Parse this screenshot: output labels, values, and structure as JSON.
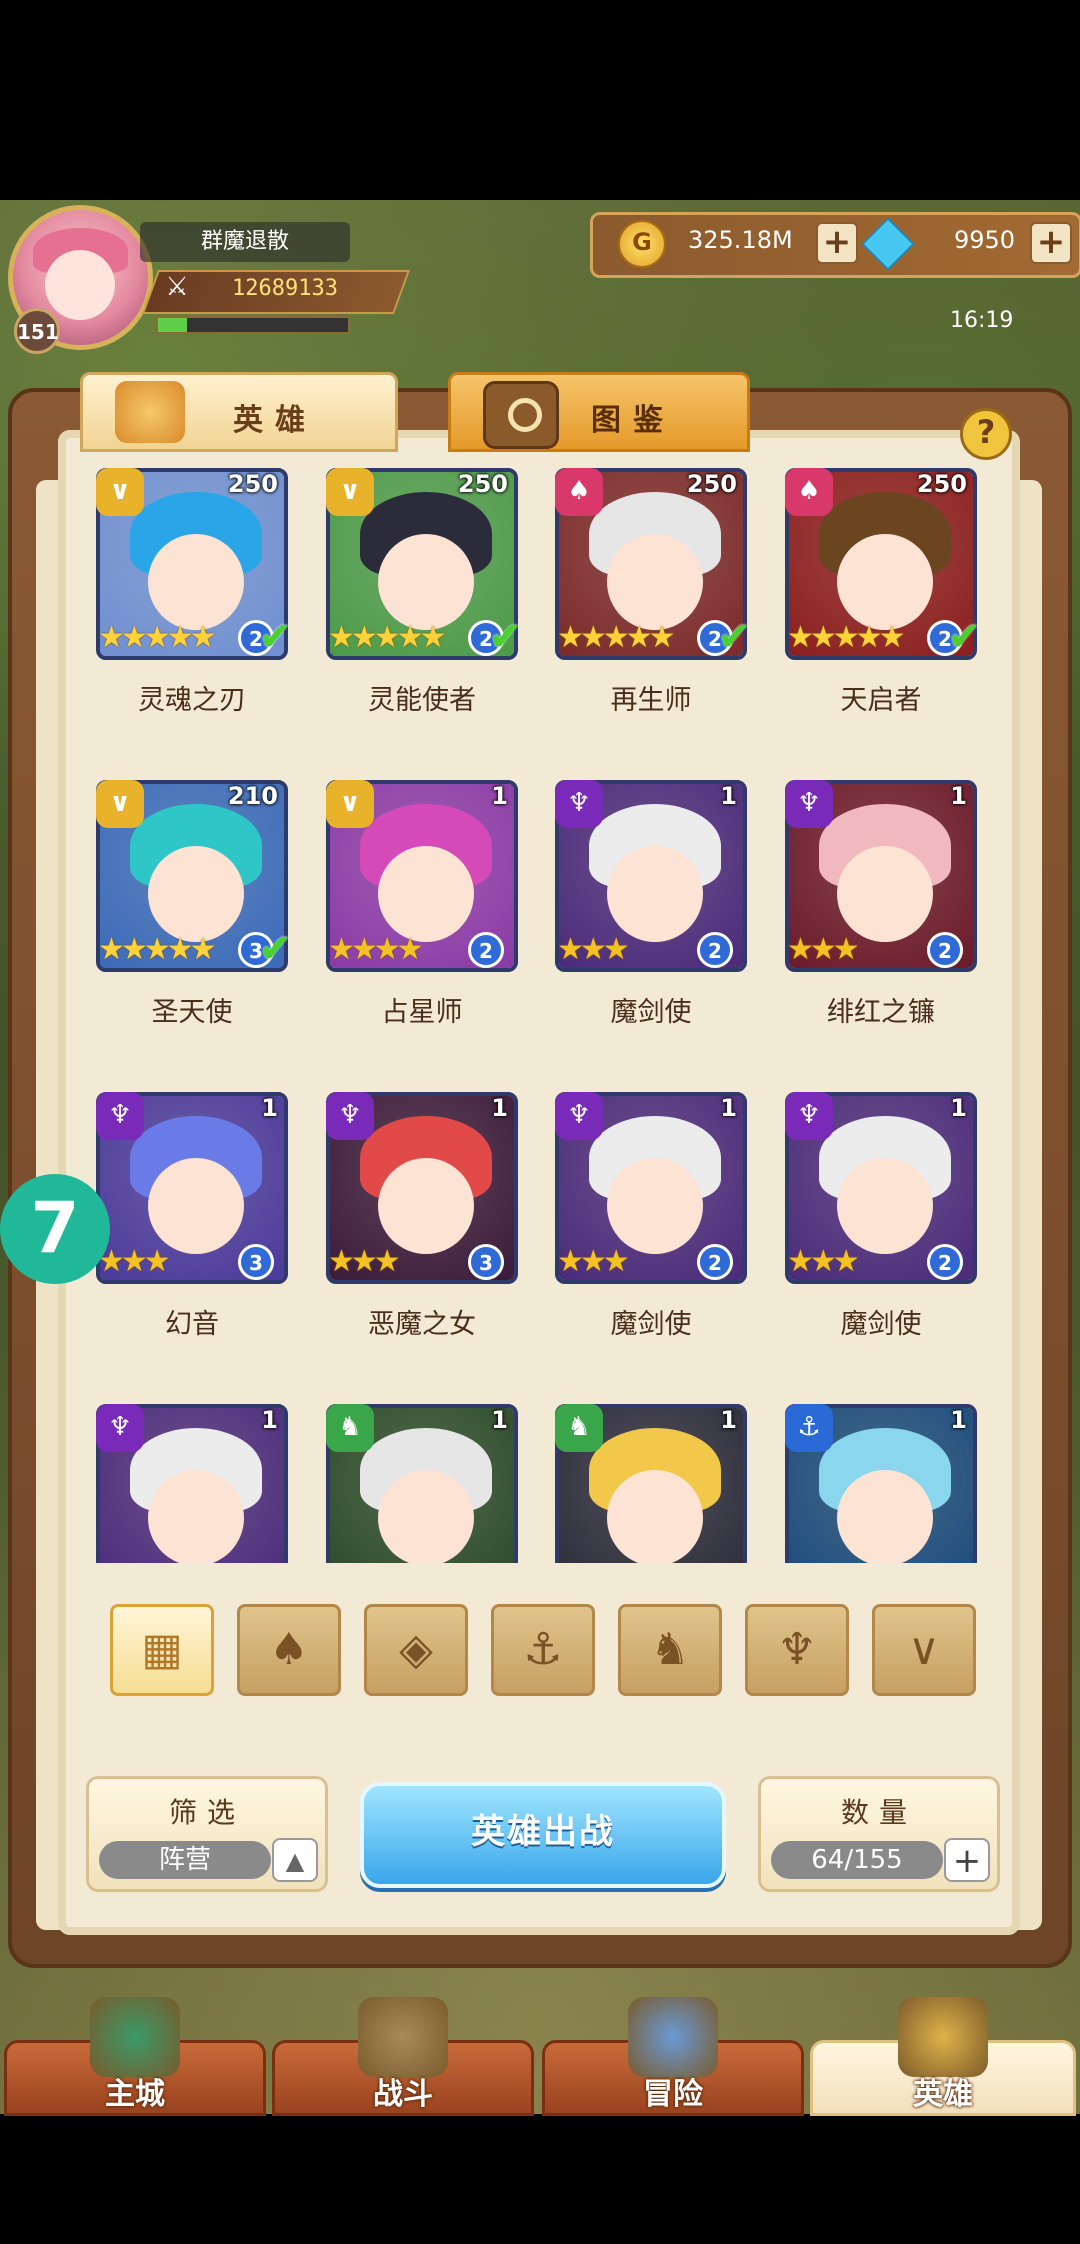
{
  "player": {
    "name": "群魔退散",
    "level": "151",
    "power": "12689133",
    "xp_fraction": 0.15
  },
  "resources": {
    "gold": "325.18M",
    "gems": "9950"
  },
  "clock": "16:19",
  "tabs": {
    "hero": "英雄",
    "codex": "图鉴",
    "help": "?"
  },
  "heroes": [
    {
      "name": "灵魂之刃",
      "level": "250",
      "rank": "2",
      "stars": 5,
      "rainbow": true,
      "owned_check": true,
      "class_icon": "chevron-icon",
      "class_color": "#e8b32a",
      "hair": "#2aa6e8",
      "bg": "#6e8fd1"
    },
    {
      "name": "灵能使者",
      "level": "250",
      "rank": "2",
      "stars": 5,
      "rainbow": true,
      "owned_check": true,
      "class_icon": "chevron-icon",
      "class_color": "#e8b32a",
      "hair": "#2b2b3a",
      "bg": "#4c9a4a"
    },
    {
      "name": "再生师",
      "level": "250",
      "rank": "2",
      "stars": 5,
      "rainbow": true,
      "owned_check": true,
      "class_icon": "lotus-icon",
      "class_color": "#d8386a",
      "hair": "#e6e6e6",
      "bg": "#7a2a2a"
    },
    {
      "name": "天启者",
      "level": "250",
      "rank": "2",
      "stars": 5,
      "rainbow": true,
      "owned_check": true,
      "class_icon": "lotus-icon",
      "class_color": "#d8386a",
      "hair": "#6b4420",
      "bg": "#8a1e1e"
    },
    {
      "name": "圣天使",
      "level": "210",
      "rank": "3",
      "stars": 5,
      "rainbow": true,
      "owned_check": true,
      "class_icon": "chevron-icon",
      "class_color": "#e8b32a",
      "hair": "#2ec6c6",
      "bg": "#3a6ab8"
    },
    {
      "name": "占星师",
      "level": "1",
      "rank": "2",
      "stars": 4,
      "rainbow": false,
      "owned_check": false,
      "class_icon": "chevron-icon",
      "class_color": "#e8b32a",
      "hair": "#d44ab8",
      "bg": "#8a3aa6"
    },
    {
      "name": "魔剑使",
      "level": "1",
      "rank": "2",
      "stars": 3,
      "rainbow": false,
      "owned_check": false,
      "class_icon": "demon-icon",
      "class_color": "#7a2ab8",
      "hair": "#ececec",
      "bg": "#4a2a7a"
    },
    {
      "name": "绯红之镰",
      "level": "1",
      "rank": "2",
      "stars": 3,
      "rainbow": false,
      "owned_check": false,
      "class_icon": "demon-icon",
      "class_color": "#7a2ab8",
      "hair": "#f2b8c0",
      "bg": "#6a1a2a"
    },
    {
      "name": "幻音",
      "level": "1",
      "rank": "3",
      "stars": 3,
      "rainbow": false,
      "owned_check": false,
      "class_icon": "demon-icon",
      "class_color": "#7a2ab8",
      "hair": "#6a7ae6",
      "bg": "#4a3a9a"
    },
    {
      "name": "恶魔之女",
      "level": "1",
      "rank": "3",
      "stars": 3,
      "rainbow": false,
      "owned_check": false,
      "class_icon": "demon-icon",
      "class_color": "#7a2ab8",
      "hair": "#e24a4a",
      "bg": "#3a1a3a"
    },
    {
      "name": "魔剑使",
      "level": "1",
      "rank": "2",
      "stars": 3,
      "rainbow": false,
      "owned_check": false,
      "class_icon": "demon-icon",
      "class_color": "#7a2ab8",
      "hair": "#ececec",
      "bg": "#4a2a7a"
    },
    {
      "name": "魔剑使",
      "level": "1",
      "rank": "2",
      "stars": 3,
      "rainbow": false,
      "owned_check": false,
      "class_icon": "demon-icon",
      "class_color": "#7a2ab8",
      "hair": "#ececec",
      "bg": "#4a2a7a"
    },
    {
      "name": "",
      "level": "1",
      "rank": "",
      "stars": 0,
      "rainbow": false,
      "owned_check": false,
      "class_icon": "demon-icon",
      "class_color": "#7a2ab8",
      "hair": "#ececec",
      "bg": "#4a2a7a"
    },
    {
      "name": "",
      "level": "1",
      "rank": "",
      "stars": 0,
      "rainbow": false,
      "owned_check": false,
      "class_icon": "beast-icon",
      "class_color": "#3aa64a",
      "hair": "#e6e6e6",
      "bg": "#2a4a2a"
    },
    {
      "name": "",
      "level": "1",
      "rank": "",
      "stars": 0,
      "rainbow": false,
      "owned_check": false,
      "class_icon": "beast-icon",
      "class_color": "#3aa64a",
      "hair": "#f2c84a",
      "bg": "#2a2a3a"
    },
    {
      "name": "",
      "level": "1",
      "rank": "",
      "stars": 0,
      "rainbow": false,
      "owned_check": false,
      "class_icon": "anchor-icon",
      "class_color": "#2a6ad6",
      "hair": "#8ad6ec",
      "bg": "#1a4a7a"
    }
  ],
  "faction_filters": [
    {
      "name": "all-icon",
      "glyph": "▦",
      "active": true
    },
    {
      "name": "lotus-icon",
      "glyph": "♠",
      "active": false
    },
    {
      "name": "diamond-icon",
      "glyph": "◈",
      "active": false
    },
    {
      "name": "anchor-icon",
      "glyph": "⚓",
      "active": false
    },
    {
      "name": "beast-icon",
      "glyph": "♞",
      "active": false
    },
    {
      "name": "demon-icon",
      "glyph": "♆",
      "active": false
    },
    {
      "name": "chevron-icon",
      "glyph": "∨",
      "active": false
    }
  ],
  "controls": {
    "filter_title": "筛选",
    "filter_value": "阵营",
    "deploy": "英雄出战",
    "count_title": "数量",
    "count_value": "64/155"
  },
  "overlay_badge": "7",
  "nav": [
    {
      "label": "主城",
      "active": false
    },
    {
      "label": "战斗",
      "active": false
    },
    {
      "label": "冒险",
      "active": false
    },
    {
      "label": "英雄",
      "active": true
    }
  ]
}
